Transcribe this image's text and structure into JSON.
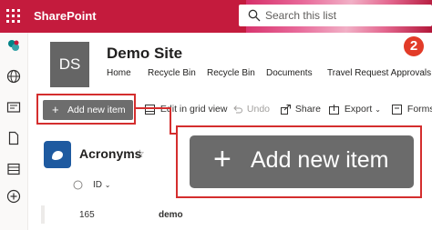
{
  "app": {
    "name": "SharePoint"
  },
  "search": {
    "placeholder": "Search this list"
  },
  "step_badge": "2",
  "site": {
    "logo_initials": "DS",
    "title": "Demo Site",
    "nav": [
      "Home",
      "Recycle Bin",
      "Recycle Bin",
      "Documents",
      "Travel Request Approvals De"
    ]
  },
  "commands": {
    "new_item": "Add new item",
    "grid": "Edit in grid view",
    "undo": "Undo",
    "share": "Share",
    "export": "Export",
    "forms": "Forms"
  },
  "callout": {
    "label": "Add new item"
  },
  "list": {
    "title": "Acronyms",
    "columns": {
      "id": "ID"
    },
    "rows": [
      {
        "id": "165",
        "title": "demo"
      }
    ]
  },
  "colors": {
    "suite_bar": "#c41b3d",
    "highlight": "#d42e2e",
    "button": "#6d6d6d",
    "badge": "#e23b28"
  }
}
